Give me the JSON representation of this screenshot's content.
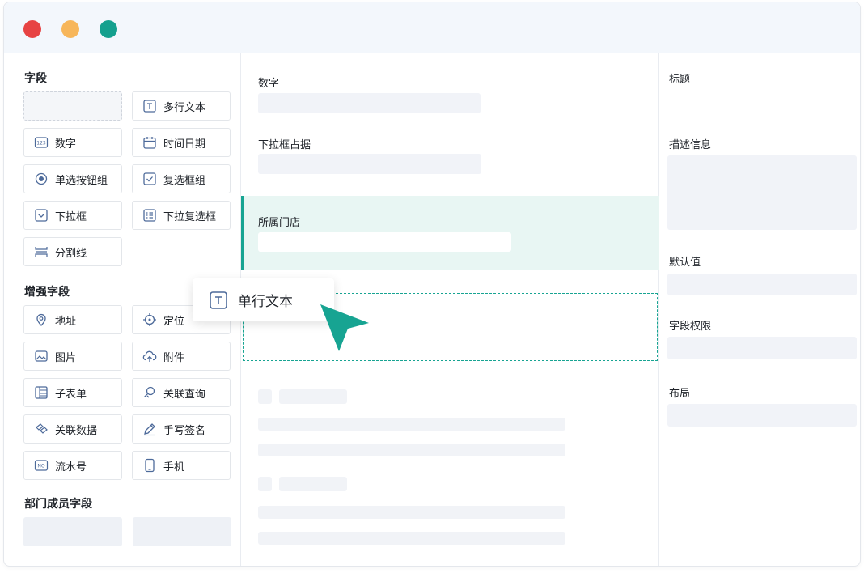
{
  "colors": {
    "accent": "#17a492",
    "close_dot": "#e74343",
    "minimize_dot": "#f7b65a",
    "maximize_dot": "#14a08e",
    "icon_blue": "#4d6a9a"
  },
  "left_panel": {
    "basic_title": "字段",
    "basic_fields": [
      {
        "label": "",
        "icon": "empty-slot"
      },
      {
        "label": "多行文本",
        "icon": "text-icon"
      },
      {
        "label": "数字",
        "icon": "number-icon"
      },
      {
        "label": "时间日期",
        "icon": "calendar-icon"
      },
      {
        "label": "单选按钮组",
        "icon": "radio-icon"
      },
      {
        "label": "复选框组",
        "icon": "checkbox-icon"
      },
      {
        "label": "下拉框",
        "icon": "dropdown-icon"
      },
      {
        "label": "下拉复选框",
        "icon": "checklist-icon"
      },
      {
        "label": "分割线",
        "icon": "divider-icon"
      }
    ],
    "enhanced_title": "增强字段",
    "enhanced_fields": [
      {
        "label": "地址",
        "icon": "map-pin-icon"
      },
      {
        "label": "定位",
        "icon": "locate-icon"
      },
      {
        "label": "图片",
        "icon": "image-icon"
      },
      {
        "label": "附件",
        "icon": "upload-cloud-icon"
      },
      {
        "label": "子表单",
        "icon": "subform-icon"
      },
      {
        "label": "关联查询",
        "icon": "search-link-icon"
      },
      {
        "label": "关联数据",
        "icon": "link-data-icon"
      },
      {
        "label": "手写签名",
        "icon": "pen-icon"
      },
      {
        "label": "流水号",
        "icon": "serial-number-icon"
      },
      {
        "label": "手机",
        "icon": "phone-icon"
      }
    ],
    "dept_title": "部门成员字段"
  },
  "canvas": {
    "fields": [
      {
        "label": "数字"
      },
      {
        "label": "下拉框占据"
      },
      {
        "label": "所属门店"
      }
    ]
  },
  "drag": {
    "label": "单行文本",
    "icon": "text-icon"
  },
  "properties": {
    "title_label": "标题",
    "description_label": "描述信息",
    "default_label": "默认值",
    "permission_label": "字段权限",
    "layout_label": "布局"
  }
}
